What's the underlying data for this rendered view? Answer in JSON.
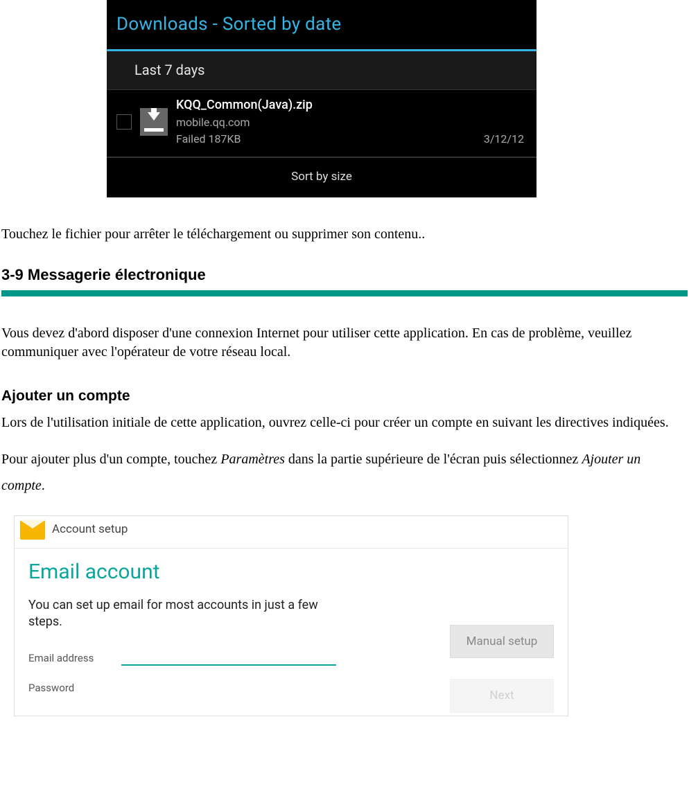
{
  "downloads_screenshot": {
    "title": "Downloads - Sorted by date",
    "section_label": "Last 7 days",
    "item": {
      "filename": "KQQ_Common(Java).zip",
      "source": "mobile.qq.com",
      "status": "Failed   187KB",
      "date": "3/12/12"
    },
    "sort_button": "Sort by size"
  },
  "doc": {
    "p_touch": "Touchez le fichier pour arrêter le téléchargement ou supprimer son contenu..",
    "h_section": "3-9 Messagerie électronique",
    "p_intro": "Vous devez d'abord disposer d'une connexion Internet pour utiliser cette application. En cas de problème, veuillez communiquer avec l'opérateur de votre réseau local.",
    "h_sub": "Ajouter un compte",
    "p_add1": "Lors de l'utilisation initiale de cette application, ouvrez celle-ci pour créer un compte en suivant les directives indiquées.",
    "p_add2_pre": "Pour ajouter plus d'un compte, touchez ",
    "p_add2_em1": "Paramètres",
    "p_add2_mid": " dans la partie supérieure de l'écran puis sélectionnez ",
    "p_add2_em2": "Ajouter un compte",
    "p_add2_post": "."
  },
  "email_screenshot": {
    "header_title": "Account setup",
    "heading": "Email account",
    "description": "You can set up email for most accounts in just a few steps.",
    "fields": {
      "email_label": "Email address",
      "password_label": "Password"
    },
    "buttons": {
      "manual": "Manual setup",
      "next": "Next"
    }
  }
}
